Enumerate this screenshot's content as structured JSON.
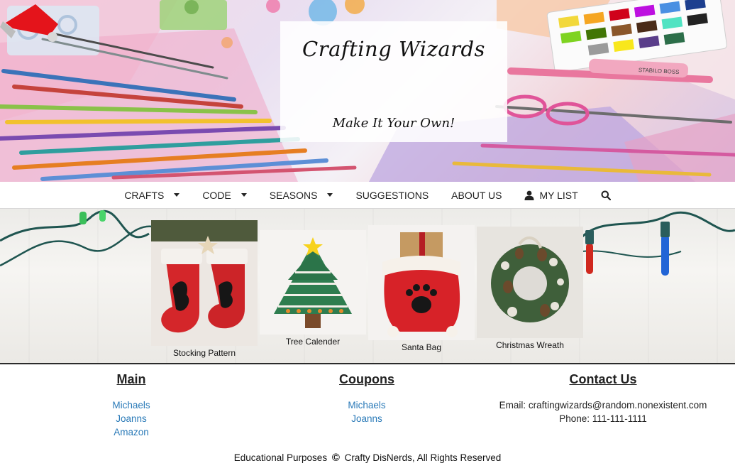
{
  "banner": {
    "title": "Crafting Wizards",
    "tagline": "Make It Your Own!",
    "marker_brand": "STABILO BOSS"
  },
  "nav": {
    "items": [
      {
        "label": "CRAFTS",
        "dropdown": true
      },
      {
        "label": "CODE",
        "dropdown": true
      },
      {
        "label": "SEASONS",
        "dropdown": true
      },
      {
        "label": "SUGGESTIONS",
        "dropdown": false
      },
      {
        "label": "ABOUT US",
        "dropdown": false
      }
    ],
    "my_list": "MY LIST",
    "icons": {
      "my_list": "user-icon",
      "search": "search-icon"
    }
  },
  "featured": [
    {
      "label": "Stocking Pattern",
      "image": "stockings"
    },
    {
      "label": "Tree Calender",
      "image": "felt-tree-advent-calendar"
    },
    {
      "label": "Santa Bag",
      "image": "red-paw-santa-bag"
    },
    {
      "label": "Christmas Wreath",
      "image": "pinecone-wreath"
    }
  ],
  "footer": {
    "main": {
      "heading": "Main",
      "links": [
        "Michaels",
        "Joanns",
        "Amazon"
      ]
    },
    "coupons": {
      "heading": "Coupons",
      "links": [
        "Michaels",
        "Joanns"
      ]
    },
    "contact": {
      "heading": "Contact Us",
      "email": "Email: craftingwizards@random.nonexistent.com",
      "phone": "Phone: 111-111-1111"
    },
    "copyright_left": "Educational Purposes",
    "copyright_symbol": "©",
    "copyright_right": "Crafty DisNerds, All Rights Reserved"
  },
  "colors": {
    "link": "#2a7ab8",
    "hat_red": "#e4141b",
    "stocking_red": "#d4262a",
    "tree_green": "#2e7d4f",
    "divider": "#2b2b2b"
  }
}
